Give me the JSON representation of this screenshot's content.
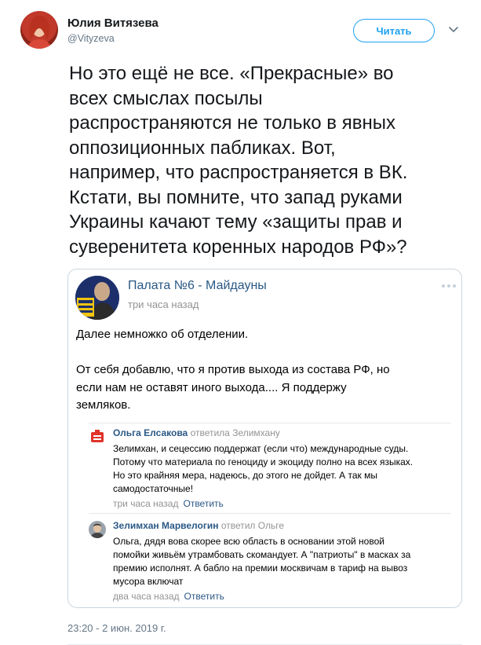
{
  "author": {
    "name": "Юлия Витязева",
    "handle": "@Vityzeva",
    "avatar_icon": "profile-photo"
  },
  "follow_label": "Читать",
  "menu_icon": "chevron-down-icon",
  "tweet_text": "Но это ещё не все. «Прекрасные» во\nвсех смыслах посылы\nраспространяются не только в явных\nоппозиционных пабликах. Вот,\nнапример, что распространяется в ВК.\nКстати, вы помните, что запад руками\nУкраины качают тему «защиты прав и\nсуверенитета коренных народов РФ»?",
  "embedded_post": {
    "group_name": "Палата №6 - Майдауны",
    "time": "три часа назад",
    "text": "Далее немножко об отделении.\n\nОт себя добавлю, что я против выхода из состава РФ, но\nесли нам не оставят иного выхода.... Я поддержу\nземляков.",
    "comments": [
      {
        "author": "Ольга Елсакова",
        "action": "ответила Зелимхану",
        "text": "Зелимхан, и сецессию поддержат (если что) международные суды.\nПотому что материала по геноциду и экоциду полно на всех языках.\nНо это крайняя мера, надеюсь, до этого не дойдет. А так мы\nсамодостаточные!",
        "time": "три часа назад",
        "reply_label": "Ответить"
      },
      {
        "author": "Зелимхан Марвелогин",
        "action": "ответил Ольге",
        "text": "Ольга, дядя вова скорее всю область в основании этой новой\nпомойки живьём утрамбовать скомандует. А \"патриоты\" в масках за\nпремию исполнят. А бабло на премии москвичам в тариф на вывоз\nмусора включат",
        "time": "два часа назад",
        "reply_label": "Ответить"
      }
    ]
  },
  "timestamp": "23:20 - 2 июн. 2019 г.",
  "colors": {
    "accent": "#1da1f2",
    "vk_link": "#2a5885",
    "muted": "#657786"
  }
}
